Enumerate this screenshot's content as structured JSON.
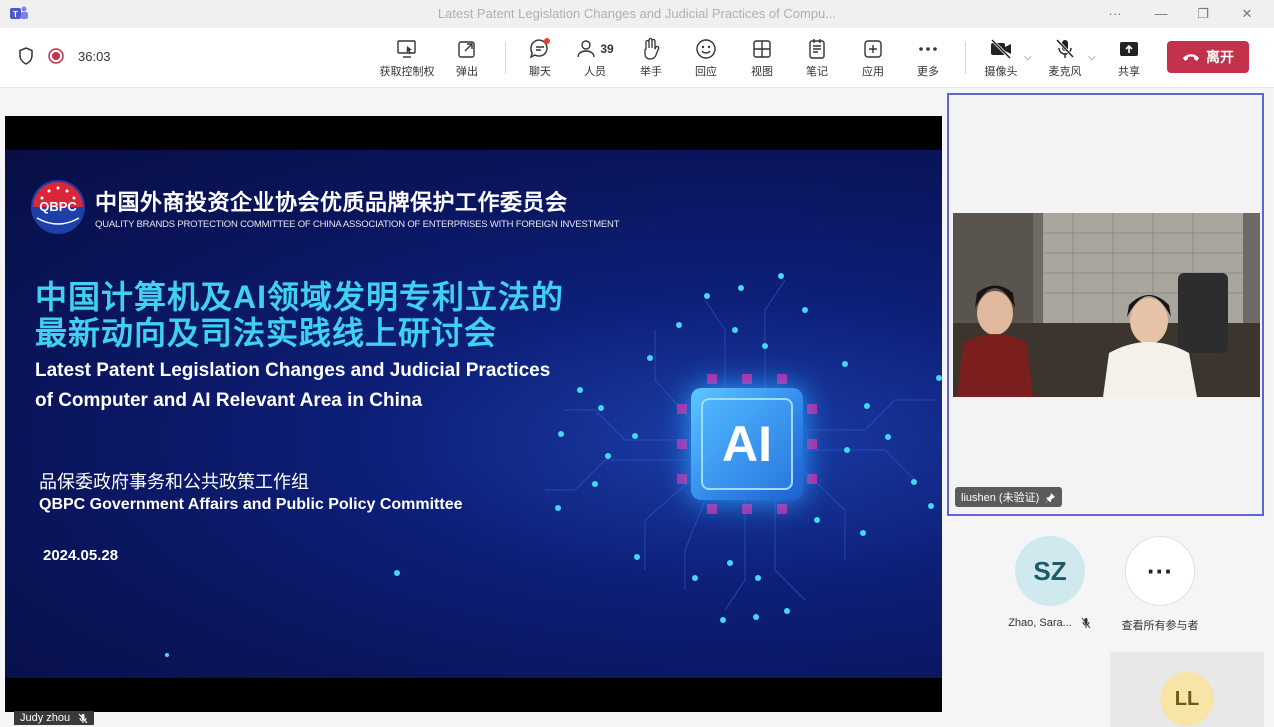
{
  "window": {
    "title": "Latest Patent Legislation Changes and Judicial Practices of Compu...",
    "controls": {
      "more": "···",
      "minimize": "—",
      "restore": "❐",
      "close": "✕"
    }
  },
  "meeting": {
    "timer": "36:03",
    "icons": {
      "shield": "shield-icon",
      "recording": "record-icon"
    }
  },
  "toolbar": {
    "take_control": "获取控制权",
    "pop_out": "弹出",
    "chat": "聊天",
    "people": "人员",
    "people_count": "39",
    "raise_hand": "举手",
    "react": "回应",
    "view": "视图",
    "notes": "笔记",
    "apps": "应用",
    "more": "更多",
    "camera": "摄像头",
    "mic": "麦克风",
    "share": "共享",
    "leave": "离开",
    "colors": {
      "leave": "#c4314b",
      "accent": "#6264d6",
      "notification_dot": "#e0422f"
    }
  },
  "slide": {
    "logo_text": "QBPC",
    "org_cn": "中国外商投资企业协会优质品牌保护工作委员会",
    "org_en": "QUALITY BRANDS PROTECTION COMMITTEE OF CHINA ASSOCIATION OF ENTERPRISES WITH FOREIGN INVESTMENT",
    "title_cn_line1": "中国计算机及AI领域发明专利立法的",
    "title_cn_line2": "最新动向及司法实践线上研讨会",
    "title_en_line1": "Latest Patent Legislation Changes and Judicial Practices",
    "title_en_line2": "of Computer and AI Relevant Area in China",
    "group_cn": "品保委政府事务和公共政策工作组",
    "group_en": "QBPC Government Affairs and Public Policy Committee",
    "date": "2024.05.28",
    "chip_label": "AI"
  },
  "presenter": {
    "name": "Judy zhou",
    "mic_state": "muted"
  },
  "participants": {
    "spotlight": {
      "name": "liushen (未验证)",
      "pinned": true
    },
    "list": [
      {
        "initials": "SZ",
        "name": "Zhao, Sara...",
        "mic_state": "muted",
        "avatar_bg": "#cfe9ee",
        "avatar_fg": "#1e5b66"
      },
      {
        "initials": "···",
        "name": "查看所有参与者"
      }
    ],
    "bottom": {
      "initials": "LL"
    }
  }
}
